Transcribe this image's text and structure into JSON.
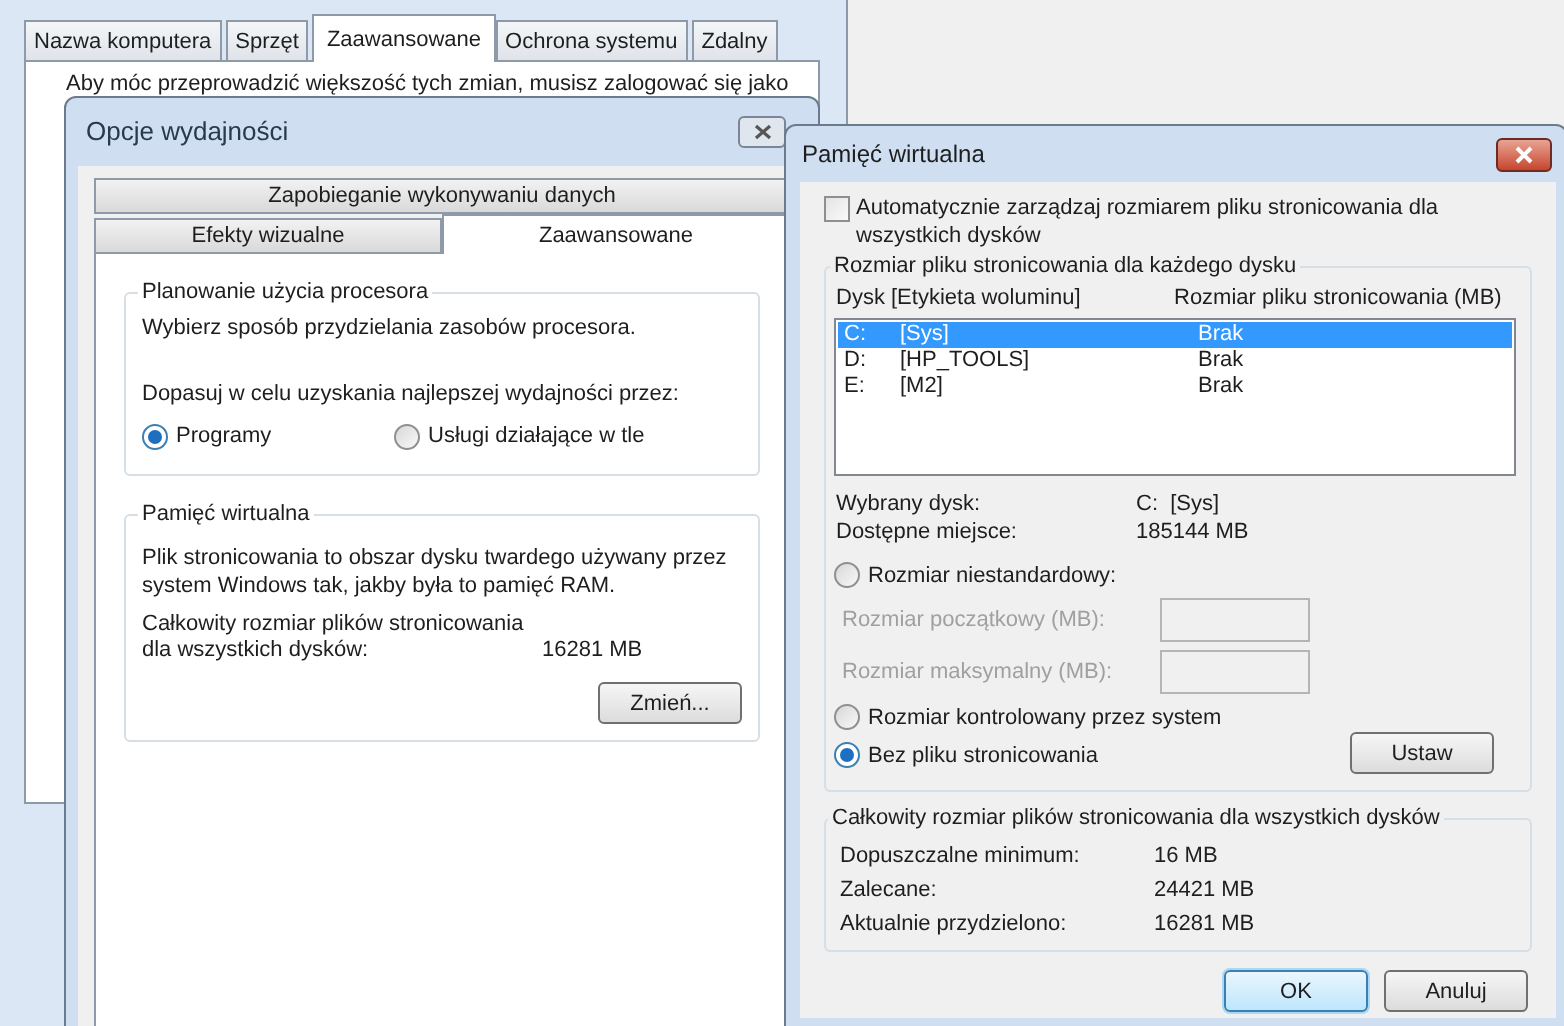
{
  "background_window": {
    "tabs": [
      {
        "label": "Nazwa komputera",
        "selected": false
      },
      {
        "label": "Sprzęt",
        "selected": false
      },
      {
        "label": "Zaawansowane",
        "selected": true
      },
      {
        "label": "Ochrona systemu",
        "selected": false
      },
      {
        "label": "Zdalny",
        "selected": false
      }
    ],
    "notice": "Aby móc przeprowadzić większość tych zmian, musisz zalogować się jako"
  },
  "performance_window": {
    "title": "Opcje wydajności",
    "tab_rows": [
      [
        {
          "label": "Zapobieganie wykonywaniu danych",
          "selected": false
        }
      ],
      [
        {
          "label": "Efekty wizualne",
          "selected": false
        },
        {
          "label": "Zaawansowane",
          "selected": true
        }
      ]
    ],
    "processor_group": {
      "title": "Planowanie użycia procesora",
      "description": "Wybierz sposób przydzielania zasobów procesora.",
      "prompt": "Dopasuj w celu uzyskania najlepszej wydajności przez:",
      "options": [
        {
          "label": "Programy",
          "selected": true
        },
        {
          "label": "Usługi działające w tle",
          "selected": false
        }
      ]
    },
    "memory_group": {
      "title": "Pamięć wirtualna",
      "description": "Plik stronicowania to obszar dysku twardego używany przez system Windows tak, jakby była to pamięć RAM.",
      "total_label": "Całkowity rozmiar plików stronicowania dla wszystkich dysków:",
      "total_value": "16281 MB",
      "button": "Zmień..."
    }
  },
  "virtual_memory_window": {
    "title": "Pamięć wirtualna",
    "auto_manage": {
      "label": "Automatycznie zarządzaj rozmiarem pliku stronicowania dla wszystkich dysków",
      "checked": false
    },
    "drives_group": {
      "title": "Rozmiar pliku stronicowania dla każdego dysku",
      "columns": [
        "Dysk [Etykieta woluminu]",
        "Rozmiar pliku stronicowania (MB)"
      ],
      "rows": [
        {
          "drive": "C:",
          "label": "[Sys]",
          "size": "Brak",
          "selected": true
        },
        {
          "drive": "D:",
          "label": "[HP_TOOLS]",
          "size": "Brak",
          "selected": false
        },
        {
          "drive": "E:",
          "label": "[M2]",
          "size": "Brak",
          "selected": false
        }
      ],
      "details": [
        {
          "label": "Wybrany dysk:",
          "value": "C:  [Sys]"
        },
        {
          "label": "Dostępne miejsce:",
          "value": "185144 MB"
        }
      ],
      "size_options": [
        {
          "kind": "radio",
          "label": "Rozmiar niestandardowy:",
          "selected": false
        },
        {
          "kind": "field",
          "label": "Rozmiar początkowy (MB):",
          "disabled": true
        },
        {
          "kind": "field",
          "label": "Rozmiar maksymalny (MB):",
          "disabled": true
        },
        {
          "kind": "radio",
          "label": "Rozmiar kontrolowany przez system",
          "selected": false
        },
        {
          "kind": "radio",
          "label": "Bez pliku stronicowania",
          "selected": true
        }
      ],
      "set_button": "Ustaw"
    },
    "totals_group": {
      "title": "Całkowity rozmiar plików stronicowania dla wszystkich dysków",
      "rows": [
        {
          "label": "Dopuszczalne minimum:",
          "value": "16 MB"
        },
        {
          "label": "Zalecane:",
          "value": "24421 MB"
        },
        {
          "label": "Aktualnie przydzielono:",
          "value": "16281 MB"
        }
      ]
    },
    "buttons": [
      {
        "label": "OK",
        "default": true
      },
      {
        "label": "Anuluj",
        "default": false
      }
    ]
  }
}
